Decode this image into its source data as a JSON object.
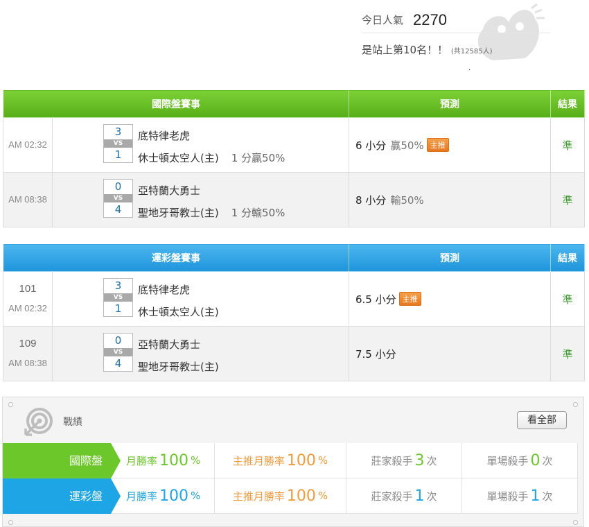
{
  "popularity": {
    "label": "今日人氣",
    "count": "2270",
    "rank_text": "是站上第10名！！",
    "total_text": "(共12585人)",
    "dot": "."
  },
  "intl": {
    "headers": [
      "國際盤賽事",
      "預測",
      "結果"
    ],
    "rows": [
      {
        "time": "AM 02:32",
        "score_top": "3",
        "vs": "VS",
        "score_bottom": "1",
        "team_top": "底特律老虎",
        "team_bottom": "休士頓太空人(主)",
        "handicap": "1 分贏50%",
        "pred": "6 小分",
        "pred_rate": "贏50%",
        "tag": "主推",
        "result": "準"
      },
      {
        "time": "AM 08:38",
        "score_top": "0",
        "vs": "VS",
        "score_bottom": "4",
        "team_top": "亞特蘭大勇士",
        "team_bottom": "聖地牙哥教士(主)",
        "handicap": "1 分輸50%",
        "pred": "8 小分",
        "pred_rate": "輸50%",
        "result": "準"
      }
    ]
  },
  "lottery": {
    "headers": [
      "運彩盤賽事",
      "預測",
      "結果"
    ],
    "rows": [
      {
        "no": "101",
        "time": "AM 02:32",
        "score_top": "3",
        "vs": "VS",
        "score_bottom": "1",
        "team_top": "底特律老虎",
        "team_bottom": "休士頓太空人(主)",
        "pred": "6.5 小分",
        "tag": "主推",
        "result": "準"
      },
      {
        "no": "109",
        "time": "AM 08:38",
        "score_top": "0",
        "vs": "VS",
        "score_bottom": "4",
        "team_top": "亞特蘭大勇士",
        "team_bottom": "聖地牙哥教士(主)",
        "pred": "7.5 小分",
        "result": "準"
      }
    ]
  },
  "record": {
    "title": "戰績",
    "all_button": "看全部",
    "rows": [
      {
        "label": "國際盤",
        "month_label": "月勝率",
        "month_val": "100",
        "pct": "%",
        "main_label": "主推月勝率",
        "main_val": "100",
        "banker_label": "莊家殺手",
        "banker_val": "3",
        "times": "次",
        "single_label": "單場殺手",
        "single_val": "0"
      },
      {
        "label": "運彩盤",
        "month_label": "月勝率",
        "month_val": "100",
        "pct": "%",
        "main_label": "主推月勝率",
        "main_val": "100",
        "banker_label": "莊家殺手",
        "banker_val": "1",
        "times": "次",
        "single_label": "單場殺手",
        "single_val": "1"
      }
    ]
  },
  "colors": {
    "green": "#6cc82a",
    "blue": "#1ea5e6",
    "orange": "#f39a3a",
    "result": "#3a9a2a"
  }
}
